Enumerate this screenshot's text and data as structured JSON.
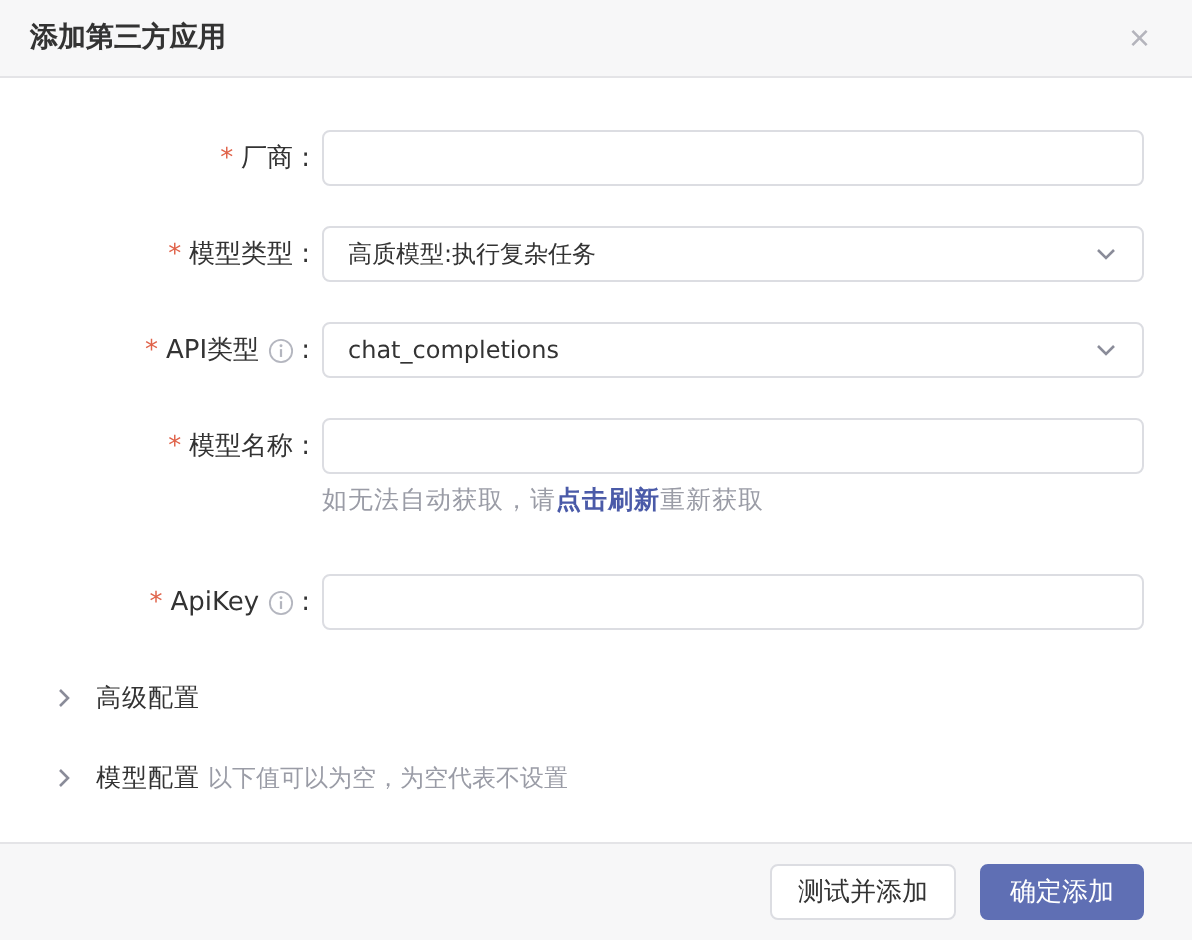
{
  "dialog": {
    "title": "添加第三方应用",
    "close": "×"
  },
  "fields": [
    {
      "kind": "input",
      "required_mark": "*",
      "label": "厂商",
      "info": false,
      "colon": ":"
    },
    {
      "kind": "select",
      "required_mark": "*",
      "label": "模型类型",
      "info": false,
      "colon": ":",
      "value": "高质模型:执行复杂任务"
    },
    {
      "kind": "select",
      "required_mark": "*",
      "label": "API类型",
      "info": true,
      "colon": ":",
      "value": "chat_completions"
    },
    {
      "kind": "input",
      "required_mark": "*",
      "label": "模型名称",
      "info": false,
      "colon": ":",
      "hint": {
        "before": "如无法自动获取，请",
        "link": "点击刷新",
        "after": "重新获取"
      }
    },
    {
      "kind": "input",
      "required_mark": "*",
      "label": "ApiKey",
      "info": true,
      "colon": ":"
    }
  ],
  "sections": [
    {
      "title": "高级配置",
      "expanded": false
    },
    {
      "title": "模型配置",
      "note": "以下值可以为空，为空代表不设置",
      "expanded": false
    }
  ],
  "buttons": [
    {
      "label": "测试并添加",
      "primary": false
    },
    {
      "label": "确定添加",
      "primary": true
    }
  ]
}
